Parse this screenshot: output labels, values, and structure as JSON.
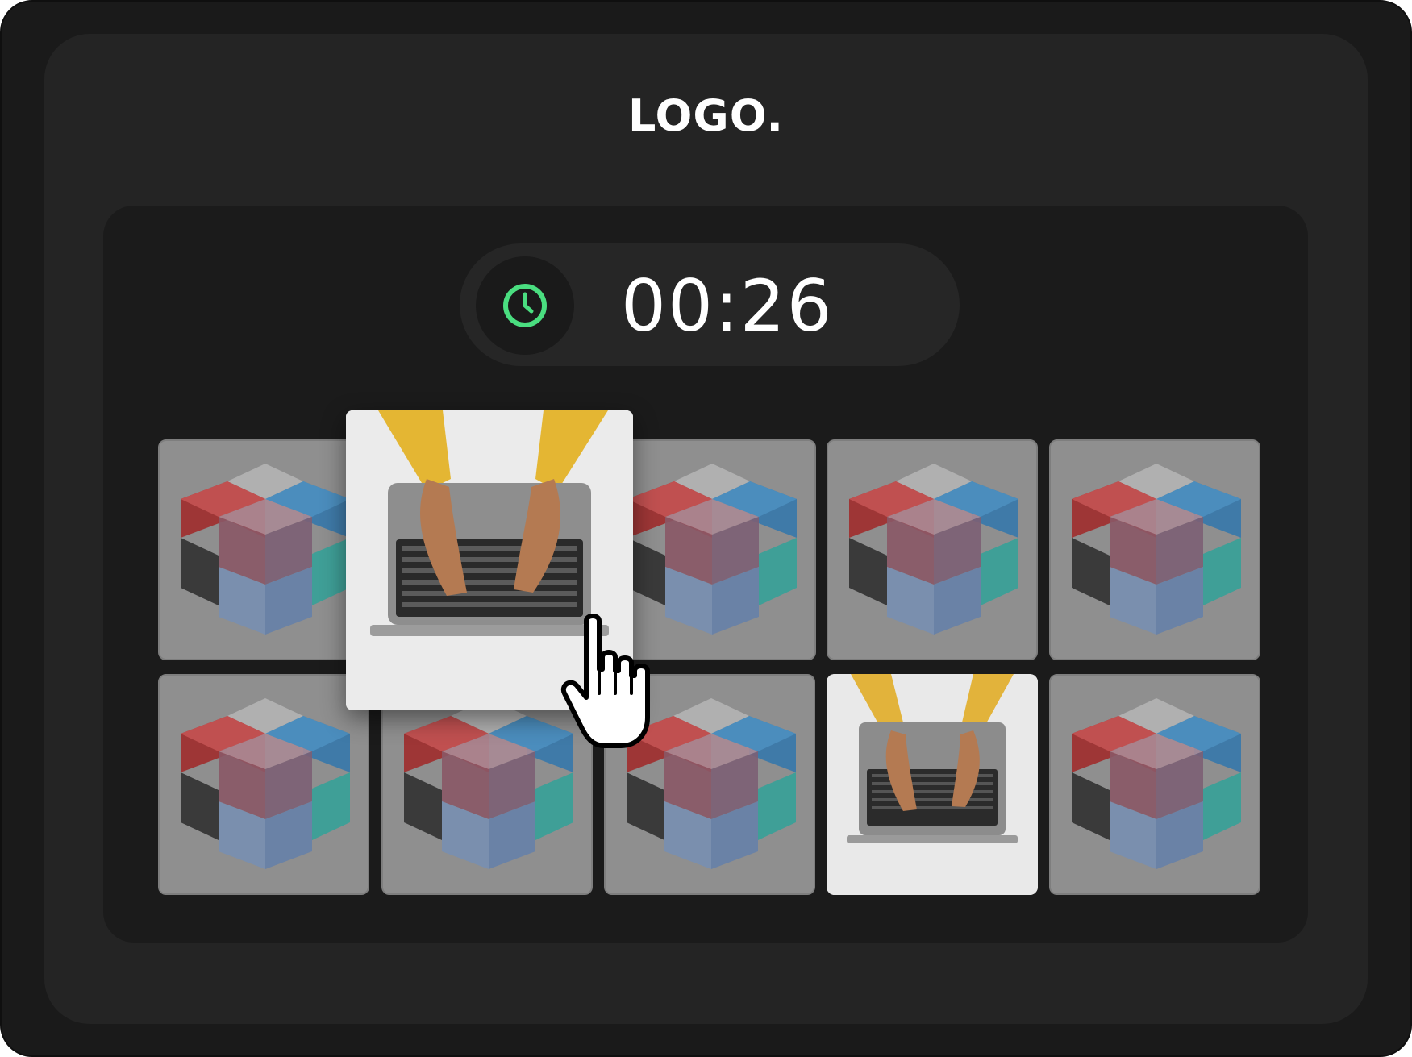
{
  "logo": {
    "text": "LOGO."
  },
  "timer": {
    "icon": "clock-icon",
    "value": "00:26",
    "accent_color": "#4ade80"
  },
  "cards": [
    {
      "row": 1,
      "col": 1,
      "state": "face-down",
      "image": "cube"
    },
    {
      "row": 1,
      "col": 2,
      "state": "revealed",
      "image": "laptop-typing"
    },
    {
      "row": 1,
      "col": 3,
      "state": "face-down",
      "image": "cube"
    },
    {
      "row": 1,
      "col": 4,
      "state": "face-down",
      "image": "cube"
    },
    {
      "row": 1,
      "col": 5,
      "state": "face-down",
      "image": "cube"
    },
    {
      "row": 2,
      "col": 1,
      "state": "face-down",
      "image": "cube"
    },
    {
      "row": 2,
      "col": 2,
      "state": "face-down",
      "image": "cube"
    },
    {
      "row": 2,
      "col": 3,
      "state": "face-down",
      "image": "cube"
    },
    {
      "row": 2,
      "col": 4,
      "state": "revealed",
      "image": "laptop-typing"
    },
    {
      "row": 2,
      "col": 5,
      "state": "face-down",
      "image": "cube"
    }
  ],
  "cursor": {
    "icon": "hand-pointer-icon"
  }
}
